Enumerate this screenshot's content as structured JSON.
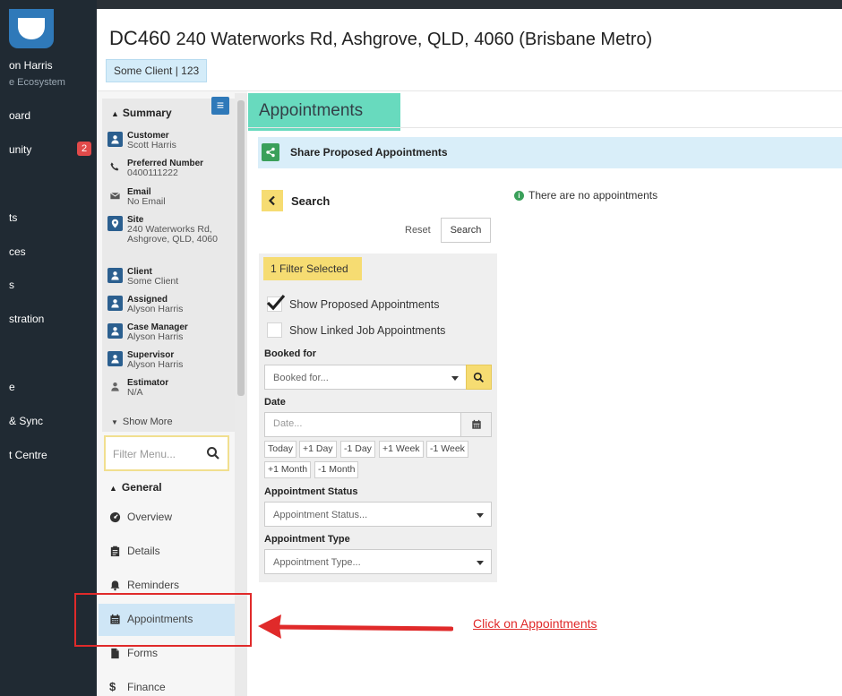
{
  "leftnav": {
    "user_name": "on Harris",
    "user_sub": "e Ecosystem",
    "items": [
      {
        "label": "oard"
      },
      {
        "label": "unity"
      },
      {
        "label": "ts"
      },
      {
        "label": "ces"
      },
      {
        "label": "s"
      },
      {
        "label": "stration"
      },
      {
        "label": "e"
      },
      {
        "label": "& Sync"
      },
      {
        "label": "t Centre"
      }
    ],
    "badge_count": "2"
  },
  "header": {
    "case_code": "DC460",
    "address": "240 Waterworks Rd, Ashgrove, QLD, 4060 (Brisbane Metro)",
    "client_chip": "Some Client | 123"
  },
  "summary": {
    "heading": "Summary",
    "rows": [
      {
        "label": "Customer",
        "value": "Scott Harris"
      },
      {
        "label": "Preferred Number",
        "value": "0400111222"
      },
      {
        "label": "Email",
        "value": "No Email"
      },
      {
        "label": "Site",
        "value": "240 Waterworks Rd, Ashgrove, QLD, 4060"
      },
      {
        "label": "Client",
        "value": "Some Client"
      },
      {
        "label": "Assigned",
        "value": "Alyson Harris"
      },
      {
        "label": "Case Manager",
        "value": "Alyson Harris"
      },
      {
        "label": "Supervisor",
        "value": "Alyson Harris"
      },
      {
        "label": "Estimator",
        "value": "N/A"
      }
    ],
    "show_more": "Show More"
  },
  "menu": {
    "filter_placeholder": "Filter Menu...",
    "general_heading": "General",
    "items": [
      {
        "label": "Overview",
        "icon": "dashboard-icon"
      },
      {
        "label": "Details",
        "icon": "clipboard-icon"
      },
      {
        "label": "Reminders",
        "icon": "bell-icon"
      },
      {
        "label": "Appointments",
        "icon": "calendar-icon"
      },
      {
        "label": "Forms",
        "icon": "file-icon"
      },
      {
        "label": "Finance",
        "icon": "dollar-icon"
      }
    ]
  },
  "main": {
    "section_title": "Appointments",
    "share_label": "Share Proposed Appointments",
    "search_heading": "Search",
    "reset_label": "Reset",
    "search_button": "Search",
    "no_appointments": "There are no appointments",
    "filters_selected": "1 Filter Selected",
    "checkboxes": [
      {
        "label": "Show Proposed Appointments",
        "checked": true
      },
      {
        "label": "Show Linked Job Appointments",
        "checked": false
      }
    ],
    "booked_for_label": "Booked for",
    "booked_for_placeholder": "Booked for...",
    "date_label": "Date",
    "date_placeholder": "Date...",
    "quick_dates": [
      "Today",
      "+1 Day",
      "-1 Day",
      "+1 Week",
      "-1 Week",
      "+1 Month",
      "-1 Month"
    ],
    "status_label": "Appointment Status",
    "status_placeholder": "Appointment Status...",
    "type_label": "Appointment Type",
    "type_placeholder": "Appointment Type..."
  },
  "annotation": {
    "note": "Click on Appointments",
    "color": "#e02a2a"
  },
  "colors": {
    "nav_dark": "#202a33",
    "accent_blue": "#2f79b9",
    "highlight_teal": "#58d7b8",
    "filter_yellow": "#f6dc72",
    "share_green": "#3aa05a"
  }
}
